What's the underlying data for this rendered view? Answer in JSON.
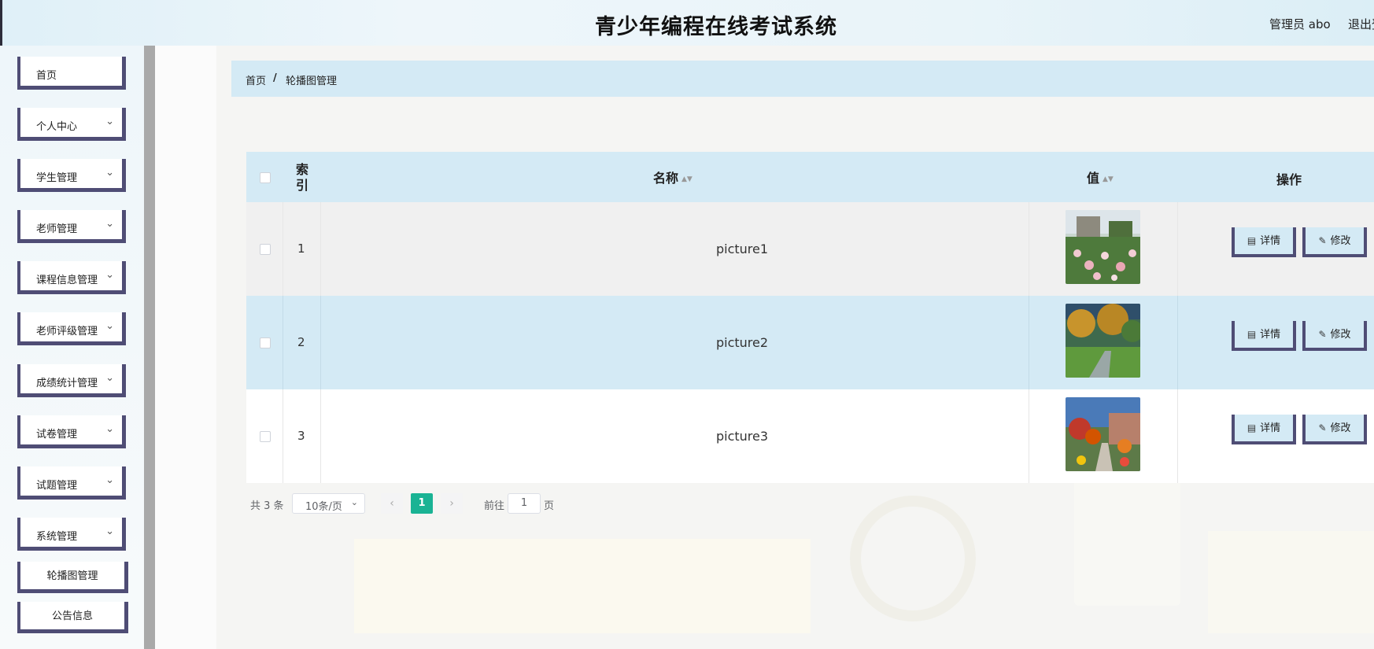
{
  "header": {
    "title": "青少年编程在线考试系统",
    "user": "管理员 abo",
    "logout": "退出登录"
  },
  "sidebar": {
    "items": [
      {
        "label": "首页",
        "has_arrow": false
      },
      {
        "label": "个人中心",
        "has_arrow": true
      },
      {
        "label": "学生管理",
        "has_arrow": true
      },
      {
        "label": "老师管理",
        "has_arrow": true
      },
      {
        "label": "课程信息管理",
        "has_arrow": true
      },
      {
        "label": "老师评级管理",
        "has_arrow": true
      },
      {
        "label": "成绩统计管理",
        "has_arrow": true
      },
      {
        "label": "试卷管理",
        "has_arrow": true
      },
      {
        "label": "试题管理",
        "has_arrow": true
      },
      {
        "label": "系统管理",
        "has_arrow": true
      }
    ],
    "sub_items": [
      {
        "label": "轮播图管理"
      },
      {
        "label": "公告信息"
      }
    ]
  },
  "breadcrumb": {
    "home": "首页",
    "separator": "/",
    "current": "轮播图管理"
  },
  "table": {
    "headers": {
      "index": "索引",
      "name": "名称",
      "value": "值",
      "actions": "操作"
    },
    "rows": [
      {
        "index": "1",
        "name": "picture1",
        "image": "garden-flowers-photo"
      },
      {
        "index": "2",
        "name": "picture2",
        "image": "autumn-trees-photo"
      },
      {
        "index": "3",
        "name": "picture3",
        "image": "campus-path-photo"
      }
    ],
    "detail_label": "详情",
    "edit_label": "修改"
  },
  "pagination": {
    "total": "共 3 条",
    "page_size": "10条/页",
    "current_page": "1",
    "goto_label": "前往",
    "goto_value": "1",
    "page_unit": "页"
  },
  "colors": {
    "accent": "#1ab394",
    "header_bg": "#d4eaf5",
    "border_dark": "#4f4d75"
  }
}
